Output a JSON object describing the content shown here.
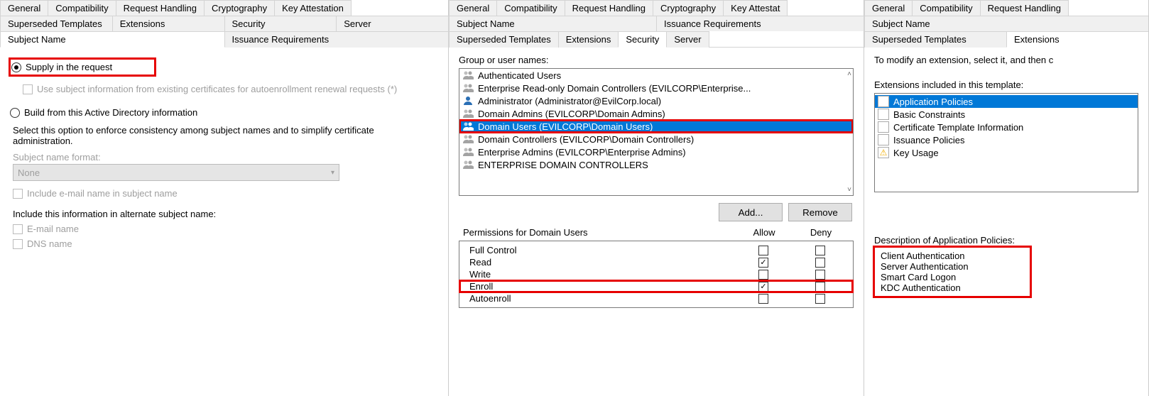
{
  "panel1": {
    "tabs_row1": [
      "General",
      "Compatibility",
      "Request Handling",
      "Cryptography",
      "Key Attestation"
    ],
    "tabs_row2": [
      "Superseded Templates",
      "Extensions",
      "Security",
      "Server"
    ],
    "tabs_row3": [
      "Subject Name",
      "Issuance Requirements"
    ],
    "active_tab": "Subject Name",
    "supply_label": "Supply in the request",
    "supply_checked": true,
    "use_existing_label": "Use subject information from existing certificates for autoenrollment renewal requests (*)",
    "build_label": "Build from this Active Directory information",
    "build_desc": "Select this option to enforce consistency among subject names and to simplify certificate administration.",
    "subj_fmt_label": "Subject name format:",
    "subj_fmt_value": "None",
    "include_email_label": "Include e-mail name in subject name",
    "alt_label": "Include this information in alternate subject name:",
    "alt_items": [
      "E-mail name",
      "DNS name"
    ]
  },
  "panel2": {
    "tabs_row1": [
      "General",
      "Compatibility",
      "Request Handling",
      "Cryptography",
      "Key Attestat"
    ],
    "tabs_row2": [
      "Subject Name",
      "Issuance Requirements"
    ],
    "tabs_row3": [
      "Superseded Templates",
      "Extensions",
      "Security",
      "Server"
    ],
    "active_tab": "Security",
    "group_label": "Group or user names:",
    "groups": [
      {
        "name": "Authenticated Users",
        "dim": true
      },
      {
        "name": "Enterprise Read-only Domain Controllers (EVILCORP\\Enterprise...",
        "dim": true
      },
      {
        "name": "Administrator (Administrator@EvilCorp.local)",
        "single": true
      },
      {
        "name": "Domain Admins (EVILCORP\\Domain Admins)",
        "dim": true
      },
      {
        "name": "Domain Users (EVILCORP\\Domain Users)",
        "selected": true,
        "hl": true
      },
      {
        "name": "Domain Controllers (EVILCORP\\Domain Controllers)",
        "dim": true
      },
      {
        "name": "Enterprise Admins (EVILCORP\\Enterprise Admins)",
        "dim": true
      },
      {
        "name": "ENTERPRISE DOMAIN CONTROLLERS",
        "dim": true
      }
    ],
    "add_btn": "Add...",
    "remove_btn": "Remove",
    "perm_label": "Permissions for Domain Users",
    "col_allow": "Allow",
    "col_deny": "Deny",
    "perms": [
      {
        "name": "Full Control",
        "allow": false,
        "deny": false
      },
      {
        "name": "Read",
        "allow": true,
        "deny": false
      },
      {
        "name": "Write",
        "allow": false,
        "deny": false
      },
      {
        "name": "Enroll",
        "allow": true,
        "deny": false,
        "hl": true
      },
      {
        "name": "Autoenroll",
        "allow": false,
        "deny": false
      }
    ]
  },
  "panel3": {
    "tabs_row1": [
      "General",
      "Compatibility",
      "Request Handling"
    ],
    "tabs_row2": [
      "Subject Name"
    ],
    "tabs_row3": [
      "Superseded Templates",
      "Extensions"
    ],
    "active_tab": "Extensions",
    "intro": "To modify an extension, select it, and then c",
    "ext_label": "Extensions included in this template:",
    "extensions": [
      {
        "name": "Application Policies",
        "selected": true
      },
      {
        "name": "Basic Constraints"
      },
      {
        "name": "Certificate Template Information"
      },
      {
        "name": "Issuance Policies"
      },
      {
        "name": "Key Usage",
        "warn": true
      }
    ],
    "desc_label": "Description of Application Policies:",
    "desc_items": [
      "Client Authentication",
      "Server Authentication",
      "Smart Card Logon",
      "KDC Authentication"
    ]
  }
}
